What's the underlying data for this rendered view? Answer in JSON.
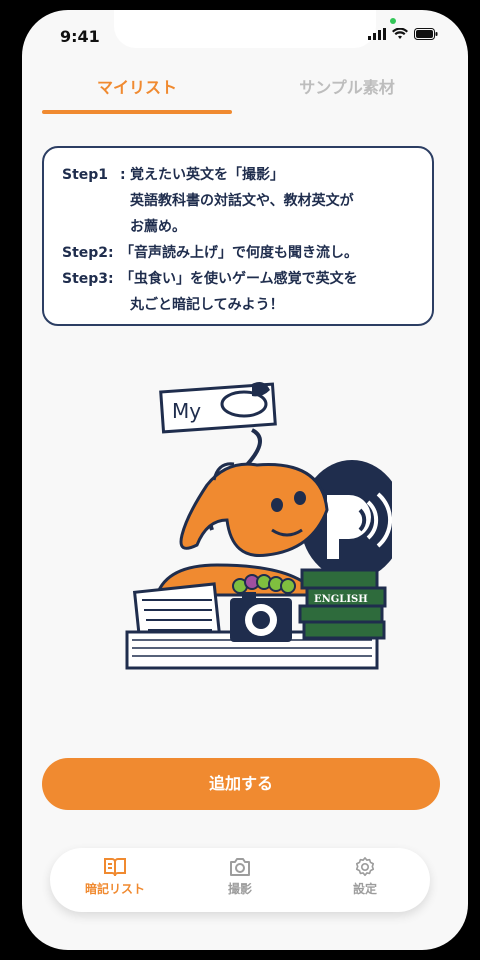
{
  "status_bar": {
    "time": "9:41"
  },
  "tabs": [
    {
      "label": "マイリスト",
      "active": true
    },
    {
      "label": "サンプル素材",
      "active": false
    }
  ],
  "instructions": {
    "step1": {
      "label": "Step1",
      "sep": ":",
      "text": "覚えたい英文を「撮影」",
      "lines": [
        "英語教科書の対話文や、教材英文が",
        "お薦め。"
      ]
    },
    "step2": {
      "label": "Step2:",
      "text": "「音声読み上げ」で何度も聞き流し。"
    },
    "step3": {
      "label": "Step3:",
      "text": "「虫食い」を使いゲーム感覚で英文を",
      "lines": [
        "丸ごと暗記してみよう！"
      ]
    }
  },
  "illustration": {
    "sign_text": "My",
    "book_label": "ENGLISH"
  },
  "add_button": {
    "label": "追加する"
  },
  "bottom_nav": [
    {
      "label": "暗記リスト",
      "icon": "book-icon",
      "active": true
    },
    {
      "label": "撮影",
      "icon": "camera-icon",
      "active": false
    },
    {
      "label": "設定",
      "icon": "gear-icon",
      "active": false
    }
  ],
  "colors": {
    "accent": "#f08a30",
    "navy": "#1f2d4d",
    "inactive": "#bdbdbd"
  }
}
